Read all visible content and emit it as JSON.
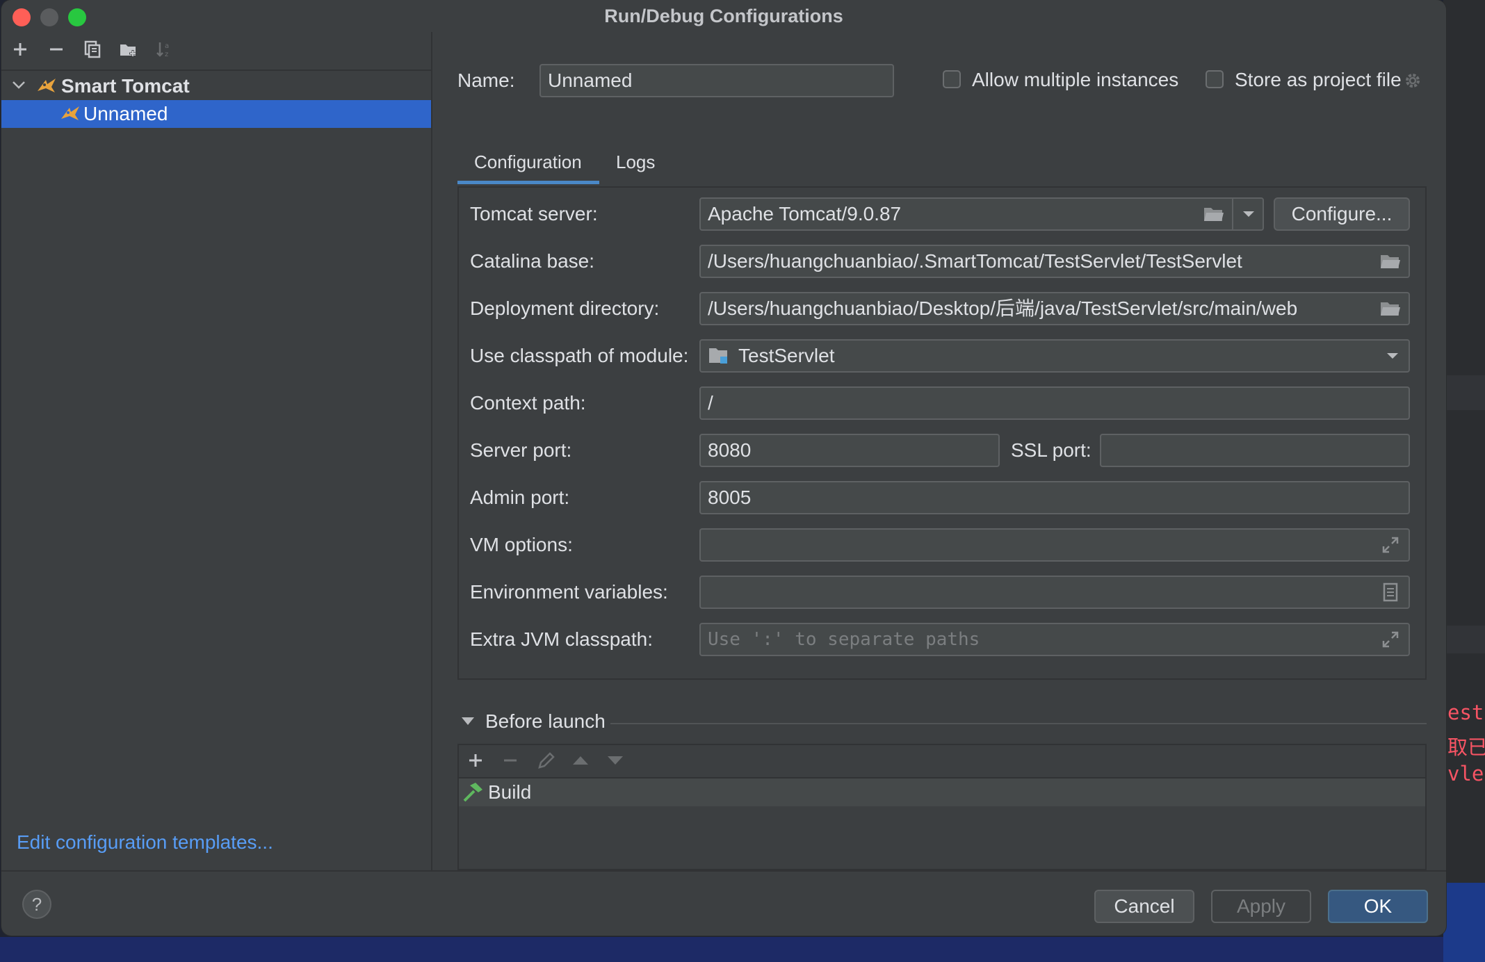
{
  "window": {
    "title": "Run/Debug Configurations"
  },
  "tree": {
    "group_label": "Smart Tomcat",
    "item_label": "Unnamed"
  },
  "left_footer": {
    "templates_link": "Edit configuration templates..."
  },
  "header": {
    "name_label": "Name:",
    "name_value": "Unnamed",
    "allow_multiple_label": "Allow multiple instances",
    "allow_multiple_checked": false,
    "store_project_label": "Store as project file",
    "store_project_checked": false
  },
  "tabs": [
    {
      "label": "Configuration",
      "active": true
    },
    {
      "label": "Logs",
      "active": false
    }
  ],
  "form": {
    "tomcat_server_label": "Tomcat server:",
    "tomcat_server_value": "Apache Tomcat/9.0.87",
    "configure_button": "Configure...",
    "catalina_base_label": "Catalina base:",
    "catalina_base_value": "/Users/huangchuanbiao/.SmartTomcat/TestServlet/TestServlet",
    "deployment_dir_label": "Deployment directory:",
    "deployment_dir_value": "/Users/huangchuanbiao/Desktop/后端/java/TestServlet/src/main/web",
    "classpath_module_label": "Use classpath of module:",
    "classpath_module_value": "TestServlet",
    "context_path_label": "Context path:",
    "context_path_value": "/",
    "server_port_label": "Server port:",
    "server_port_value": "8080",
    "ssl_port_label": "SSL port:",
    "ssl_port_value": "",
    "admin_port_label": "Admin port:",
    "admin_port_value": "8005",
    "vm_options_label": "VM options:",
    "vm_options_value": "",
    "env_vars_label": "Environment variables:",
    "env_vars_value": "",
    "extra_jvm_label": "Extra JVM classpath:",
    "extra_jvm_placeholder": "Use ':' to separate paths"
  },
  "before_launch": {
    "header": "Before launch",
    "items": [
      {
        "label": "Build"
      }
    ]
  },
  "buttons": {
    "help": "?",
    "cancel": "Cancel",
    "apply": "Apply",
    "ok": "OK"
  },
  "background_editor": {
    "lines": [
      "estS",
      "取已",
      "vlet"
    ]
  },
  "colors": {
    "dialog_bg": "#3c3f41",
    "selection": "#2f65ca",
    "link": "#589df6",
    "tab_accent": "#4a88c7",
    "ok_button": "#365880",
    "close_light": "#ff5f57",
    "minimize_light": "#5a5c5e",
    "zoom_light": "#28c840"
  }
}
